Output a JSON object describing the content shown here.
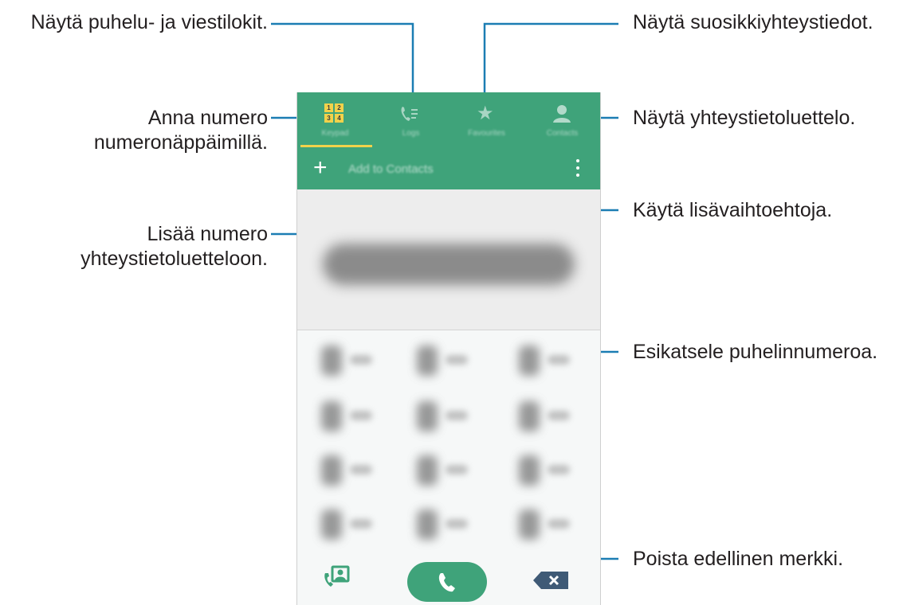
{
  "annotations": {
    "logs": "Näytä puhelu- ja viestilokit.",
    "favourites": "Näytä suosikkiyhteystiedot.",
    "keypad_line1": "Anna numero",
    "keypad_line2": "numeronäppäimillä.",
    "contacts": "Näytä yhteystietoluettelo.",
    "more_options": "Käytä lisävaihtoehtoja.",
    "add_line1": "Lisää numero",
    "add_line2": "yhteystietoluetteloon.",
    "preview": "Esikatsele puhelinnumeroa.",
    "delete": "Poista edellinen merkki."
  },
  "phone": {
    "tabs": [
      {
        "label": "Keypad",
        "icon": "keypad-icon",
        "active": true
      },
      {
        "label": "Logs",
        "icon": "logs-icon",
        "active": false
      },
      {
        "label": "Favourites",
        "icon": "star-icon",
        "active": false
      },
      {
        "label": "Contacts",
        "icon": "person-icon",
        "active": false
      }
    ],
    "keypad_icon_digits": [
      "1",
      "2",
      "3",
      "4"
    ],
    "add_to_contacts": "Add to Contacts",
    "plus_symbol": "+",
    "colors": {
      "accent_green": "#3fa37a",
      "tab_indicator": "#f2d24b",
      "delete_button": "#3f5a76",
      "annotation_line": "#1b7db3"
    }
  }
}
